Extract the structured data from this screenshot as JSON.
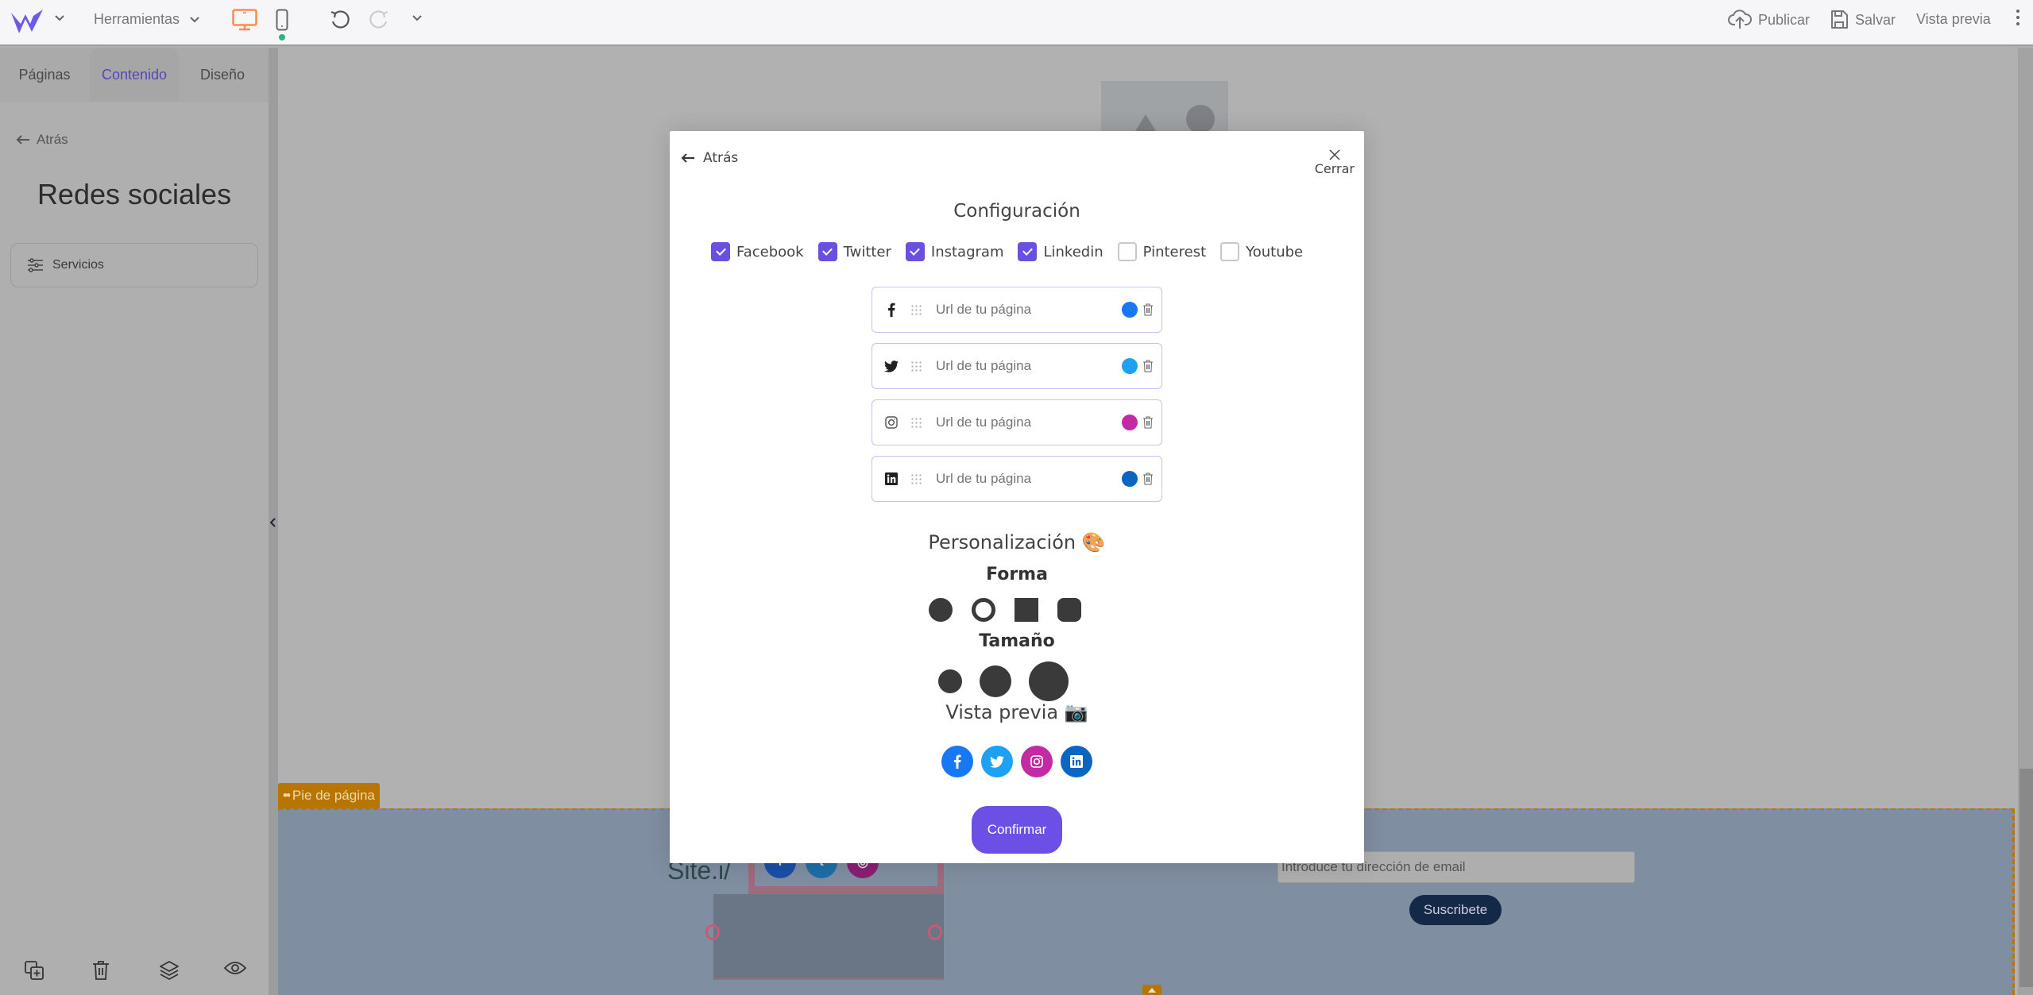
{
  "topbar": {
    "logo": "w-logo-icon",
    "tools_label": "Herramientas",
    "publish_label": "Publicar",
    "save_label": "Salvar",
    "preview_label": "Vista previa",
    "accent_desktop_color": "#ff8a4c",
    "brand_color": "#6b5ce7"
  },
  "sidebar": {
    "tabs": [
      {
        "label": "Páginas",
        "active": false
      },
      {
        "label": "Contenido",
        "active": true
      },
      {
        "label": "Diseño",
        "active": false
      }
    ],
    "back_label": "Atrás",
    "title": "Redes sociales",
    "items": [
      {
        "label": "Servicios",
        "icon": "sliders-icon"
      }
    ],
    "footer_icons": [
      "duplicate-icon",
      "trash-icon",
      "layers-icon",
      "eye-icon"
    ]
  },
  "canvas": {
    "footer_tag": "Pie de página",
    "site_name": "Site.i/",
    "email_placeholder": "Introduce tu dirección de email",
    "subscribe_label": "Suscribete"
  },
  "modal": {
    "back_label": "Atrás",
    "close_label": "Cerrar",
    "title": "Configuración",
    "networks": [
      {
        "label": "Facebook",
        "checked": true
      },
      {
        "label": "Twitter",
        "checked": true
      },
      {
        "label": "Instagram",
        "checked": true
      },
      {
        "label": "Linkedin",
        "checked": true
      },
      {
        "label": "Pinterest",
        "checked": false
      },
      {
        "label": "Youtube",
        "checked": false
      }
    ],
    "url_rows": [
      {
        "network": "facebook",
        "placeholder": "Url de tu página",
        "color": "#1877f2"
      },
      {
        "network": "twitter",
        "placeholder": "Url de tu página",
        "color": "#1da1f2"
      },
      {
        "network": "instagram",
        "placeholder": "Url de tu página",
        "color": "#c32aa3"
      },
      {
        "network": "linkedin",
        "placeholder": "Url de tu página",
        "color": "#0a66c2"
      }
    ],
    "personalization_title": "Personalización 🎨",
    "shape_title": "Forma",
    "shapes": [
      "circle",
      "ring",
      "square",
      "rounded-square"
    ],
    "size_title": "Tamaño",
    "sizes": [
      "small",
      "medium",
      "large"
    ],
    "preview_title": "Vista previa 📷",
    "confirm_label": "Confirmar",
    "confirm_color": "#6c4fe4"
  }
}
